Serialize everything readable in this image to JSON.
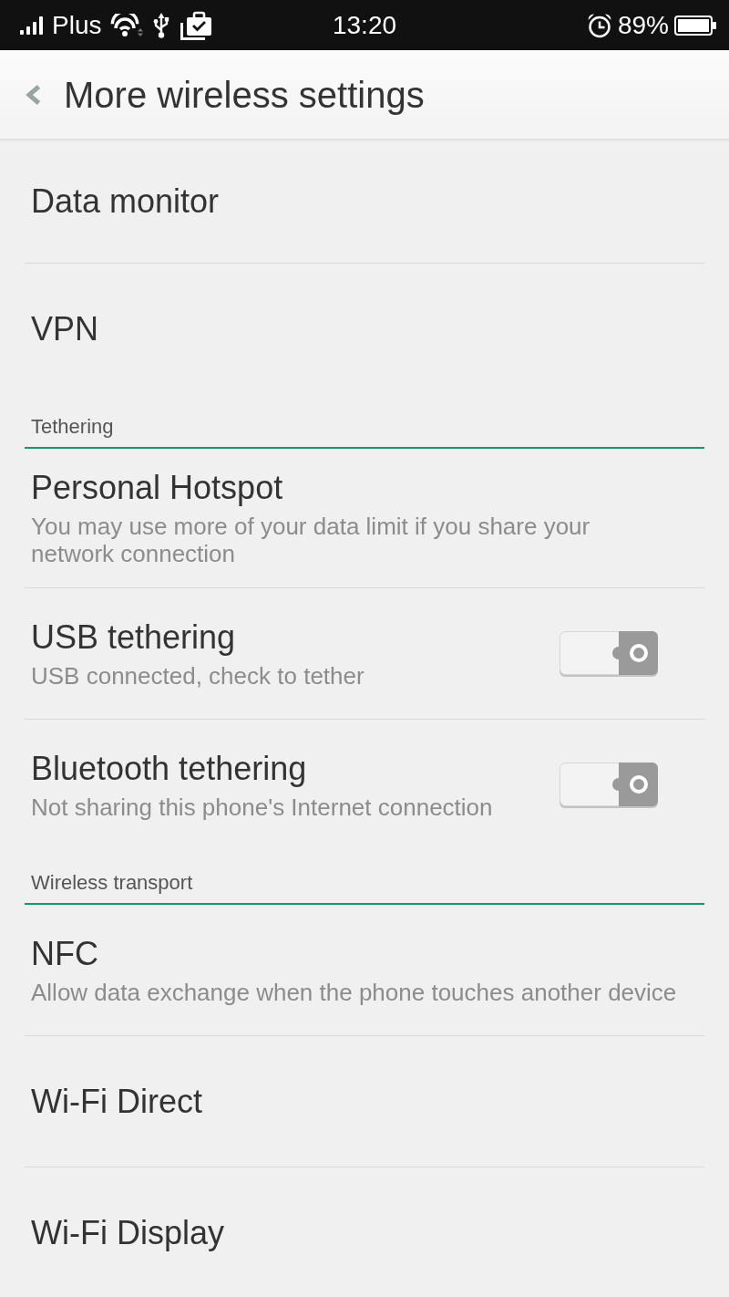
{
  "status_bar": {
    "carrier": "Plus",
    "time": "13:20",
    "battery": "89%"
  },
  "header": {
    "title": "More wireless settings"
  },
  "items": [
    {
      "kind": "item",
      "title": "Data monitor"
    },
    {
      "kind": "item",
      "title": "VPN"
    },
    {
      "kind": "section",
      "title": "Tethering"
    },
    {
      "kind": "item",
      "title": "Personal Hotspot",
      "subtitle": "You may use more of your data limit if you share your network connection"
    },
    {
      "kind": "toggle",
      "title": "USB tethering",
      "subtitle": "USB connected, check to tether",
      "on": false
    },
    {
      "kind": "toggle",
      "title": "Bluetooth tethering",
      "subtitle": "Not sharing this phone's Internet connection",
      "on": false
    },
    {
      "kind": "section",
      "title": "Wireless transport"
    },
    {
      "kind": "item",
      "title": "NFC",
      "subtitle": "Allow data exchange when the phone touches another device"
    },
    {
      "kind": "item",
      "title": "Wi-Fi Direct"
    },
    {
      "kind": "item",
      "title": "Wi-Fi Display"
    }
  ]
}
